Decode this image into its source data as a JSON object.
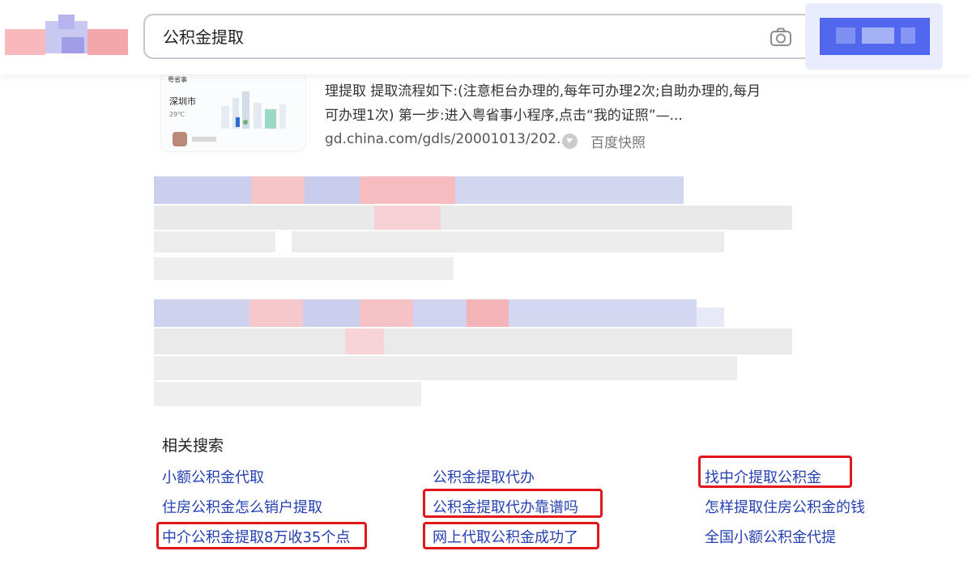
{
  "search": {
    "query": "公积金提取"
  },
  "icons": {
    "camera": "camera-icon",
    "snapshot": "snapshot-icon"
  },
  "colors": {
    "link": "#2440b3",
    "highlight_border": "#e0161a",
    "blur_title": "#c6cbec",
    "blur_accent": "#f2b3b6"
  },
  "result": {
    "thumb_header": "粤省事",
    "thumb_city": "深圳市",
    "thumb_weather": "29℃",
    "snippet_line1": "理提取 提取流程如下:(注意柜台办理的,每年可办理2次;自助办理的,每月",
    "snippet_line2": "可办理1次) 第一步:进入粤省事小程序,点击“我的证照”—...",
    "url": "gd.china.com/gdls/20001013/202...",
    "snapshot_label": "百度快照"
  },
  "related": {
    "title": "相关搜索",
    "items": [
      {
        "text": "小额公积金代取",
        "highlighted": false
      },
      {
        "text": "公积金提取代办",
        "highlighted": false
      },
      {
        "text": "找中介提取公积金",
        "highlighted": true
      },
      {
        "text": "住房公积金怎么销户提取",
        "highlighted": false
      },
      {
        "text": "公积金提取代办靠谱吗",
        "highlighted": true
      },
      {
        "text": "怎样提取住房公积金的钱",
        "highlighted": false
      },
      {
        "text": "中介公积金提取8万收35个点",
        "highlighted": true
      },
      {
        "text": "网上代取公积金成功了",
        "highlighted": true
      },
      {
        "text": "全国小额公积金代提",
        "highlighted": false
      }
    ]
  }
}
